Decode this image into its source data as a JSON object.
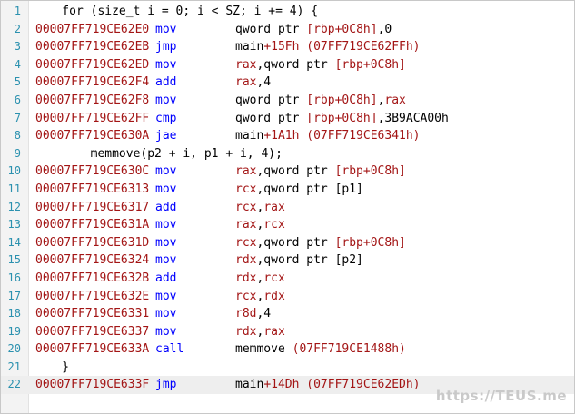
{
  "disassembly": {
    "lines": [
      {
        "n": "1",
        "type": "src",
        "text": "    for (size_t i = 0; i < SZ; i += 4) {"
      },
      {
        "n": "2",
        "type": "asm",
        "addr": "00007FF719CE62E0",
        "mn": "mov",
        "ops": [
          [
            "t",
            "qword ptr "
          ],
          [
            "r",
            "[rbp+0C8h]"
          ],
          [
            "t",
            ",0"
          ]
        ]
      },
      {
        "n": "3",
        "type": "asm",
        "addr": "00007FF719CE62EB",
        "mn": "jmp",
        "ops": [
          [
            "t",
            "main"
          ],
          [
            "r",
            "+15Fh (07FF719CE62FFh)"
          ]
        ]
      },
      {
        "n": "4",
        "type": "asm",
        "addr": "00007FF719CE62ED",
        "mn": "mov",
        "ops": [
          [
            "r",
            "rax"
          ],
          [
            "t",
            ",qword ptr "
          ],
          [
            "r",
            "[rbp+0C8h]"
          ]
        ]
      },
      {
        "n": "5",
        "type": "asm",
        "addr": "00007FF719CE62F4",
        "mn": "add",
        "ops": [
          [
            "r",
            "rax"
          ],
          [
            "t",
            ",4"
          ]
        ]
      },
      {
        "n": "6",
        "type": "asm",
        "addr": "00007FF719CE62F8",
        "mn": "mov",
        "ops": [
          [
            "t",
            "qword ptr "
          ],
          [
            "r",
            "[rbp+0C8h]"
          ],
          [
            "t",
            ","
          ],
          [
            "r",
            "rax"
          ]
        ]
      },
      {
        "n": "7",
        "type": "asm",
        "addr": "00007FF719CE62FF",
        "mn": "cmp",
        "ops": [
          [
            "t",
            "qword ptr "
          ],
          [
            "r",
            "[rbp+0C8h]"
          ],
          [
            "t",
            ",3B9ACA00h"
          ]
        ]
      },
      {
        "n": "8",
        "type": "asm",
        "addr": "00007FF719CE630A",
        "mn": "jae",
        "ops": [
          [
            "t",
            "main"
          ],
          [
            "r",
            "+1A1h (07FF719CE6341h)"
          ]
        ]
      },
      {
        "n": "9",
        "type": "src",
        "text": "        memmove(p2 + i, p1 + i, 4);"
      },
      {
        "n": "10",
        "type": "asm",
        "addr": "00007FF719CE630C",
        "mn": "mov",
        "ops": [
          [
            "r",
            "rax"
          ],
          [
            "t",
            ",qword ptr "
          ],
          [
            "r",
            "[rbp+0C8h]"
          ]
        ]
      },
      {
        "n": "11",
        "type": "asm",
        "addr": "00007FF719CE6313",
        "mn": "mov",
        "ops": [
          [
            "r",
            "rcx"
          ],
          [
            "t",
            ",qword ptr [p1]"
          ]
        ]
      },
      {
        "n": "12",
        "type": "asm",
        "addr": "00007FF719CE6317",
        "mn": "add",
        "ops": [
          [
            "r",
            "rcx"
          ],
          [
            "t",
            ","
          ],
          [
            "r",
            "rax"
          ]
        ]
      },
      {
        "n": "13",
        "type": "asm",
        "addr": "00007FF719CE631A",
        "mn": "mov",
        "ops": [
          [
            "r",
            "rax"
          ],
          [
            "t",
            ","
          ],
          [
            "r",
            "rcx"
          ]
        ]
      },
      {
        "n": "14",
        "type": "asm",
        "addr": "00007FF719CE631D",
        "mn": "mov",
        "ops": [
          [
            "r",
            "rcx"
          ],
          [
            "t",
            ",qword ptr "
          ],
          [
            "r",
            "[rbp+0C8h]"
          ]
        ]
      },
      {
        "n": "15",
        "type": "asm",
        "addr": "00007FF719CE6324",
        "mn": "mov",
        "ops": [
          [
            "r",
            "rdx"
          ],
          [
            "t",
            ",qword ptr [p2]"
          ]
        ]
      },
      {
        "n": "16",
        "type": "asm",
        "addr": "00007FF719CE632B",
        "mn": "add",
        "ops": [
          [
            "r",
            "rdx"
          ],
          [
            "t",
            ","
          ],
          [
            "r",
            "rcx"
          ]
        ]
      },
      {
        "n": "17",
        "type": "asm",
        "addr": "00007FF719CE632E",
        "mn": "mov",
        "ops": [
          [
            "r",
            "rcx"
          ],
          [
            "t",
            ","
          ],
          [
            "r",
            "rdx"
          ]
        ]
      },
      {
        "n": "18",
        "type": "asm",
        "addr": "00007FF719CE6331",
        "mn": "mov",
        "ops": [
          [
            "r",
            "r8d"
          ],
          [
            "t",
            ",4"
          ]
        ]
      },
      {
        "n": "19",
        "type": "asm",
        "addr": "00007FF719CE6337",
        "mn": "mov",
        "ops": [
          [
            "r",
            "rdx"
          ],
          [
            "t",
            ","
          ],
          [
            "r",
            "rax"
          ]
        ]
      },
      {
        "n": "20",
        "type": "asm",
        "addr": "00007FF719CE633A",
        "mn": "call",
        "ops": [
          [
            "t",
            "memmove "
          ],
          [
            "r",
            "(07FF719CE1488h)"
          ]
        ]
      },
      {
        "n": "21",
        "type": "src",
        "text": "    }"
      },
      {
        "n": "22",
        "type": "asm",
        "addr": "00007FF719CE633F",
        "mn": "jmp",
        "ops": [
          [
            "t",
            "main"
          ],
          [
            "r",
            "+14Dh (07FF719CE62EDh)"
          ]
        ],
        "current": true
      }
    ]
  },
  "watermark": "https://TEUS.me",
  "colors": {
    "address": "#a31515",
    "mnemonic": "#0000ff",
    "line_number": "#2b91af",
    "text": "#000000"
  }
}
